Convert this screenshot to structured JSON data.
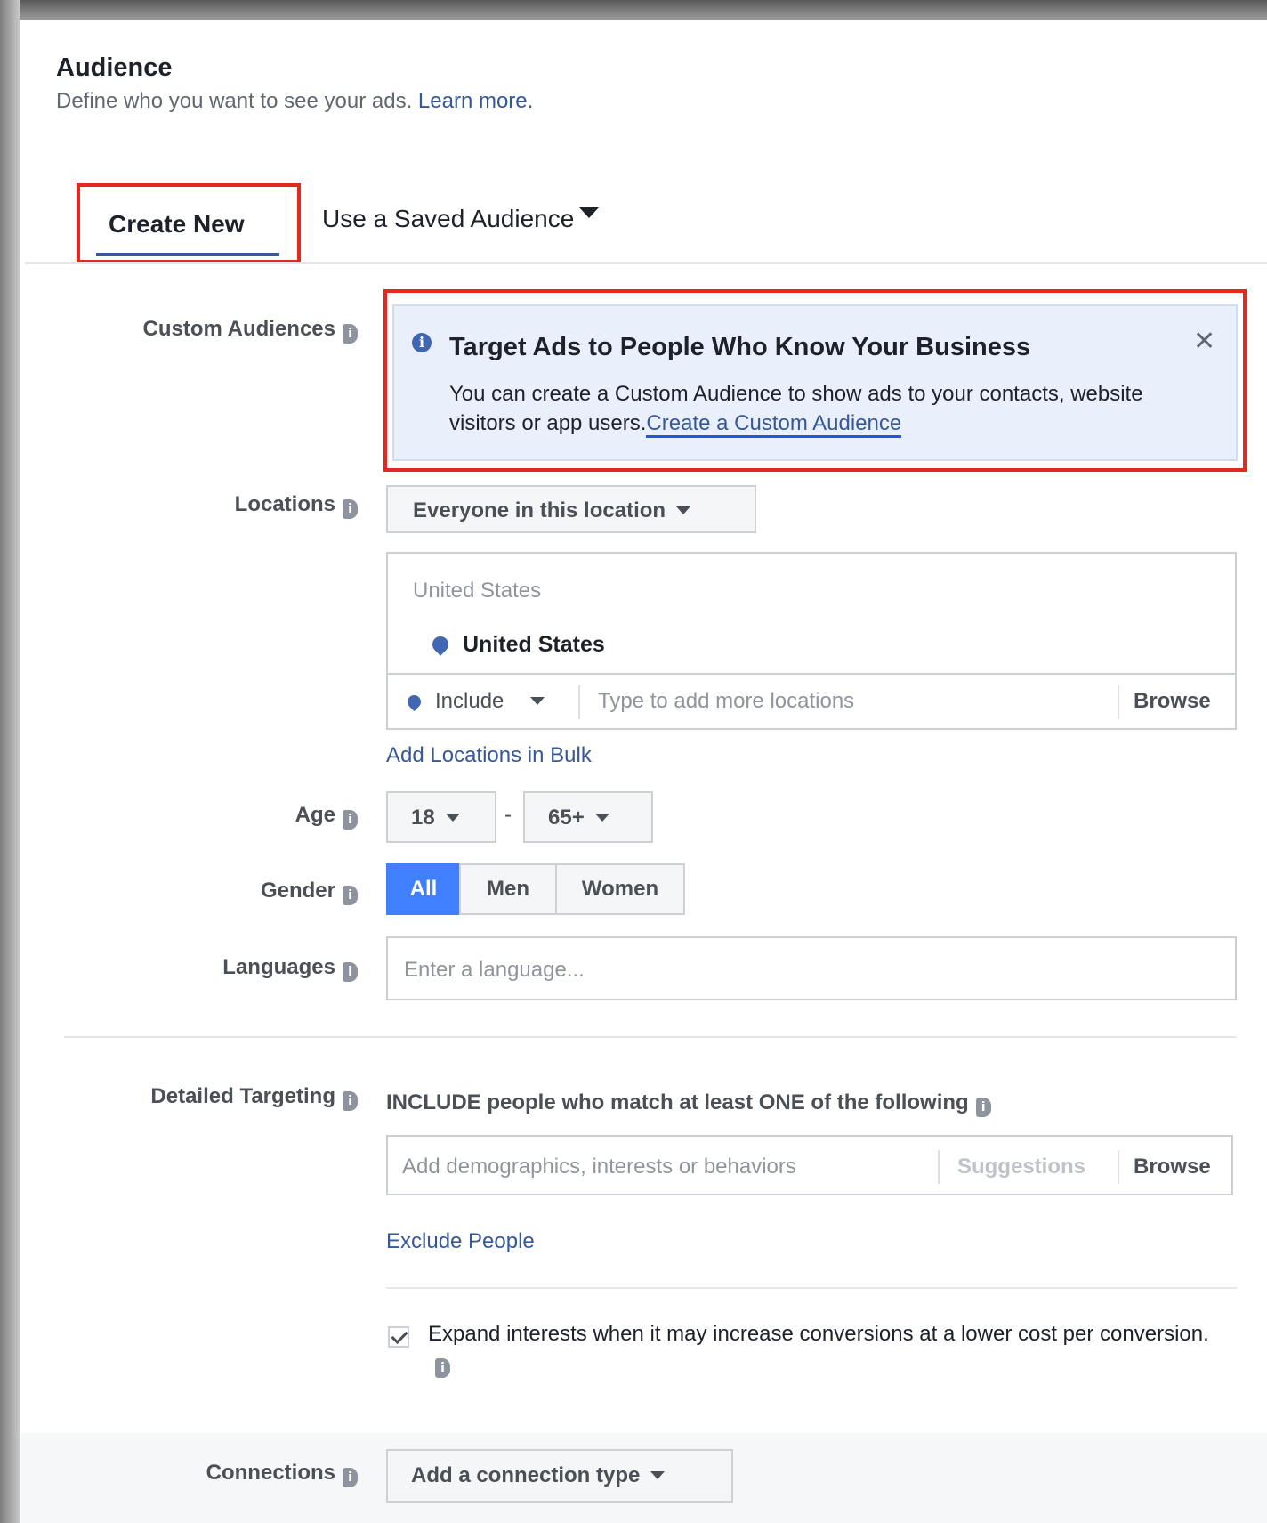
{
  "header": {
    "title": "Audience",
    "subtitle": "Define who you want to see your ads.",
    "learn_more": "Learn more."
  },
  "tabs": {
    "create_new": "Create New",
    "saved": "Use a Saved Audience"
  },
  "custom_audiences": {
    "label": "Custom Audiences",
    "callout_title": "Target Ads to People Who Know Your Business",
    "callout_body": "You can create a Custom Audience to show ads to your contacts, website visitors or app users.",
    "callout_link": "Create a Custom Audience"
  },
  "locations": {
    "label": "Locations",
    "select_value": "Everyone in this location",
    "group_header": "United States",
    "selected_item": "United States",
    "include_value": "Include",
    "input_placeholder": "Type to add more locations",
    "browse": "Browse",
    "bulk_link": "Add Locations in Bulk"
  },
  "age": {
    "label": "Age",
    "min": "18",
    "separator": "-",
    "max": "65+"
  },
  "gender": {
    "label": "Gender",
    "options": [
      "All",
      "Men",
      "Women"
    ],
    "selected": "All"
  },
  "languages": {
    "label": "Languages",
    "placeholder": "Enter a language..."
  },
  "detailed_targeting": {
    "label": "Detailed Targeting",
    "include_text": "INCLUDE people who match at least ONE of the following",
    "input_placeholder": "Add demographics, interests or behaviors",
    "suggestions": "Suggestions",
    "browse": "Browse",
    "exclude_link": "Exclude People",
    "expand_checked": true,
    "expand_text": "Expand interests when it may increase conversions at a lower cost per conversion."
  },
  "connections": {
    "label": "Connections",
    "select_value": "Add a connection type"
  },
  "colors": {
    "link": "#365899",
    "active": "#4080ff",
    "highlight_border": "#e5281d",
    "callout_bg": "#eaf0fb"
  }
}
